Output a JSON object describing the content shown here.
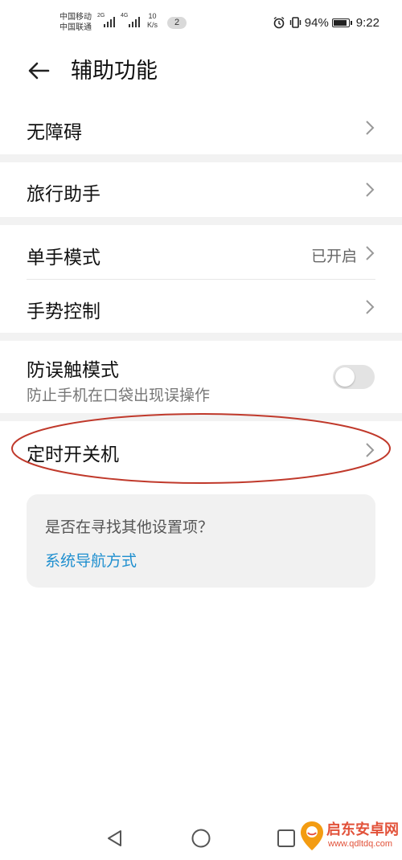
{
  "status_bar": {
    "carrier1": "中国移动",
    "carrier2": "中国联通",
    "net1": "2G",
    "net2": "4G",
    "speed_value": "10",
    "speed_unit": "K/s",
    "notification_count": "2",
    "battery": "94%",
    "battery_level": 0.94,
    "time": "9:22",
    "icons": [
      "alarm-icon",
      "vibrate-icon",
      "battery-icon"
    ]
  },
  "header": {
    "title": "辅助功能",
    "back_icon": "back-arrow-icon"
  },
  "settings": {
    "accessibility": "无障碍",
    "travel_assistant": "旅行助手",
    "one_hand_mode": {
      "label": "单手模式",
      "value": "已开启"
    },
    "gesture_control": "手势控制",
    "anti_mistouch": {
      "label": "防误触模式",
      "description": "防止手机在口袋出现误操作",
      "enabled": false
    },
    "scheduled_power": "定时开关机"
  },
  "suggestion_card": {
    "question": "是否在寻找其他设置项？",
    "link": "系统导航方式"
  },
  "watermark": {
    "text": "启东安卓网",
    "url": "www.qdltdq.com"
  },
  "colors": {
    "link": "#1f8fcf",
    "highlight_ellipse": "#c0392b",
    "separator": "#f2f2f2"
  }
}
